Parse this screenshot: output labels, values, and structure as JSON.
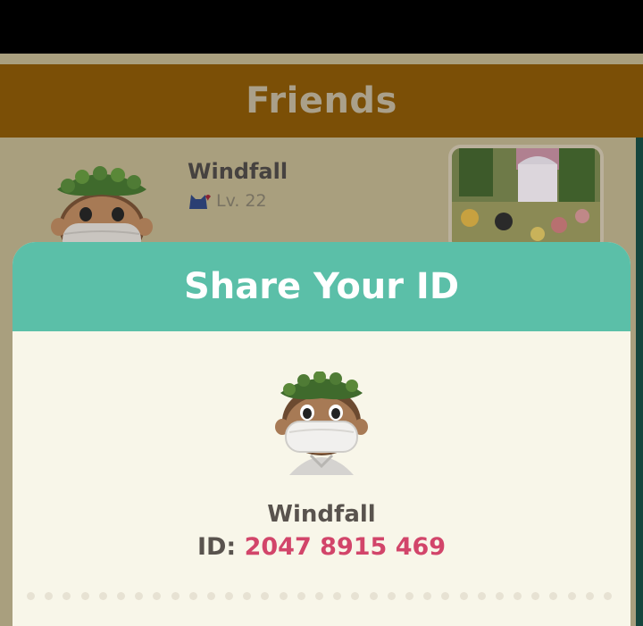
{
  "screen": {
    "header_title": "Friends"
  },
  "friend": {
    "name": "Windfall",
    "level": "Lv. 22",
    "level_icon": "cat-icon"
  },
  "dialog": {
    "title": "Share Your ID",
    "player_name": "Windfall",
    "id_label": "ID:",
    "id_value": "2047 8915 469"
  },
  "colors": {
    "header_brown": "#7b4f06",
    "dialog_teal": "#5bbfa8",
    "id_pink": "#d2456a"
  }
}
